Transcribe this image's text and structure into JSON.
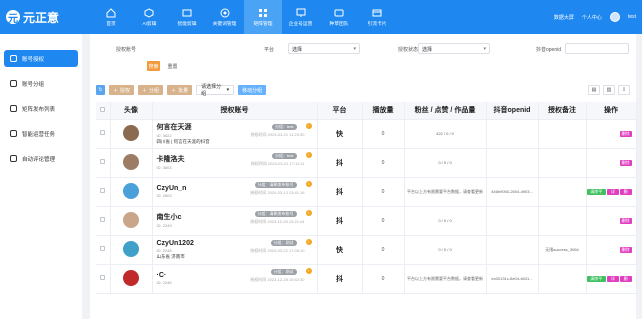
{
  "app": {
    "logo_text": "元正意",
    "logo_glyph": "元"
  },
  "nav": [
    {
      "label": "首页",
      "icon": "home-icon",
      "active": false
    },
    {
      "label": "AI剪辑",
      "icon": "cube-icon",
      "active": false
    },
    {
      "label": "智能剪辑",
      "icon": "film-icon",
      "active": false
    },
    {
      "label": "关键词管理",
      "icon": "target-icon",
      "active": false
    },
    {
      "label": "矩阵管理",
      "icon": "grid-icon",
      "active": true
    },
    {
      "label": "企业号运营",
      "icon": "monitor-icon",
      "active": false
    },
    {
      "label": "种草团队",
      "icon": "tv-icon",
      "active": false
    },
    {
      "label": "引流卡片",
      "icon": "card-icon",
      "active": false
    }
  ],
  "top_right": {
    "dashboard": "数据大屏",
    "profile": "个人中心",
    "user": "test"
  },
  "sidebar": [
    {
      "label": "账号授权",
      "active": true
    },
    {
      "label": "账号分组",
      "active": false
    },
    {
      "label": "矩阵发布列表",
      "active": false
    },
    {
      "label": "智能运营任务",
      "active": false
    },
    {
      "label": "自动评论管理",
      "active": false
    }
  ],
  "filters": {
    "account_label": "授权账号",
    "platform_label": "平台",
    "platform_value": "选择",
    "status_label": "授权状态",
    "status_value": "选择",
    "openid_label": "抖音openid"
  },
  "buttons": {
    "search": "搜索",
    "reset": "重置"
  },
  "toolbar": {
    "refresh": "↻",
    "b1": "授权",
    "b2": "分组",
    "b3": "批量",
    "group_select": "请选择分组",
    "batch_group": "移动分组"
  },
  "table": {
    "headers": [
      "",
      "头像",
      "授权账号",
      "平台",
      "播放量",
      "粉丝 / 点赞 / 作品量",
      "抖音openid",
      "授权备注",
      "操作"
    ],
    "rows": [
      {
        "avatar_color": "#8a6a50",
        "name": "何言在天涯",
        "id": "ID: 3622",
        "sub": "四川省 | 何言在天涯的抖音",
        "tag": "分组：test",
        "date": "授权时间 2024-03-21 11:23:30",
        "platform": "快",
        "plays": "0",
        "stats": "422 / 0 / 0",
        "openid": "",
        "note": "",
        "ops": [
          {
            "label": "删除",
            "color": "pink"
          }
        ]
      },
      {
        "avatar_color": "#9c7c64",
        "name": "卡隆洛夫",
        "id": "ID: 3603",
        "sub": "",
        "tag": "分组：test",
        "date": "授权时间 2024-03-21 17:11:11",
        "platform": "抖",
        "plays": "0",
        "stats": "0 / 0 / 0",
        "openid": "",
        "note": "",
        "ops": [
          {
            "label": "删除",
            "color": "pink"
          }
        ]
      },
      {
        "avatar_color": "#4aa0d8",
        "name": "CzyUn_n",
        "id": "ID: 2603",
        "sub": "",
        "tag": "分组：清朝发布账号",
        "date": "授权时间 2024-03-13 13:41:16",
        "platform": "抖",
        "plays": "0",
        "stats": "平台以上方有限需要平台数据，请查看更新",
        "openid": "446b9050-2504-4903...",
        "note": "",
        "ops": [
          {
            "label": "清除平台",
            "color": "green"
          },
          {
            "label": "详情",
            "color": "pink"
          },
          {
            "label": "删除",
            "color": "pink"
          }
        ]
      },
      {
        "avatar_color": "#c9a58a",
        "name": "南生小c",
        "id": "ID: 2249",
        "sub": "",
        "tag": "分组：清朝发布账号",
        "date": "授权时间 2023-12-29 15:21:44",
        "platform": "抖",
        "plays": "0",
        "stats": "0 / 0 / 0",
        "openid": "",
        "note": "",
        "ops": [
          {
            "label": "删除",
            "color": "pink"
          }
        ]
      },
      {
        "avatar_color": "#3fa0c8",
        "name": "CzyUn1202",
        "id": "ID: 2248",
        "sub": "山东省 济南市",
        "tag": "分组：测试",
        "date": "授权时间 2024-03-22 17:05:10",
        "platform": "快",
        "plays": "0",
        "stats": "0 / 0 / 0",
        "openid": "",
        "note": "无限success_3064",
        "ops": [
          {
            "label": "删除",
            "color": "pink"
          }
        ]
      },
      {
        "avatar_color": "#c02a2a",
        "name": "·C·",
        "id": "ID: 2246",
        "sub": "",
        "tag": "分组：测试",
        "date": "授权时间 2023-12-28 15:52:30",
        "platform": "抖",
        "plays": "0",
        "stats": "平台以上方有限需要平台数据，请查看更新",
        "openid": "ec00131c-8e04-4631...",
        "note": "",
        "ops": [
          {
            "label": "清除平台",
            "color": "green"
          },
          {
            "label": "详情",
            "color": "pink"
          },
          {
            "label": "删除",
            "color": "pink"
          }
        ]
      }
    ]
  }
}
